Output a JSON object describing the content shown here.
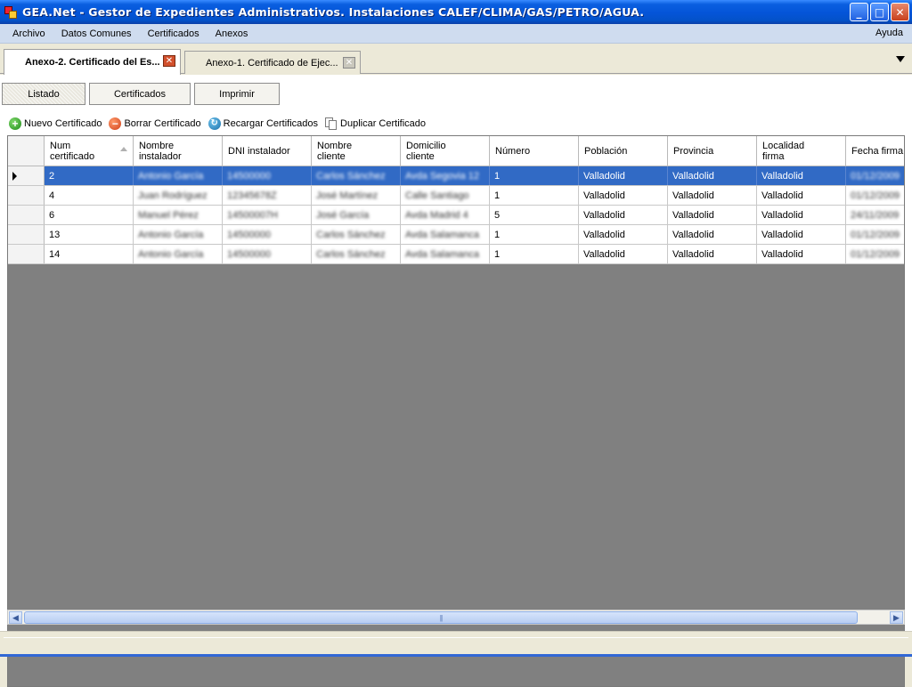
{
  "window": {
    "title": "GEA.Net - Gestor de Expedientes Administrativos. Instalaciones CALEF/CLIMA/GAS/PETRO/AGUA.",
    "controls": {
      "minimize": "_",
      "maximize": "□",
      "close": "✕"
    }
  },
  "menu": {
    "items": [
      "Archivo",
      "Datos Comunes",
      "Certificados",
      "Anexos"
    ],
    "help": "Ayuda"
  },
  "doc_tabs": [
    {
      "label": "Anexo-2. Certificado del Es...",
      "active": true
    },
    {
      "label": "Anexo-1.  Certificado  de  Ejec...",
      "active": false
    }
  ],
  "sub_tabs": [
    "Listado",
    "Certificados",
    "Imprimir"
  ],
  "toolbar": {
    "new": "Nuevo Certificado",
    "delete": "Borrar Certificado",
    "reload": "Recargar Certificados",
    "duplicate": "Duplicar Certificado"
  },
  "grid": {
    "columns": [
      "Num\ncertificado",
      "Nombre\ninstalador",
      "DNI instalador",
      "Nombre\ncliente",
      "Domicilio\ncliente",
      "Número",
      "Población",
      "Provincia",
      "Localidad\nfirma",
      "Fecha firma"
    ],
    "rows": [
      {
        "num": "2",
        "instalador": "Antonio García",
        "dni": "14500000",
        "cliente": "Carlos Sánchez",
        "domicilio": "Avda Segovia 12",
        "numero": "1",
        "poblacion": "Valladolid",
        "provincia": "Valladolid",
        "localidad": "Valladolid",
        "fecha": "01/12/2009",
        "selected": true
      },
      {
        "num": "4",
        "instalador": "Juan Rodríguez",
        "dni": "12345678Z",
        "cliente": "José Martínez",
        "domicilio": "Calle Santiago",
        "numero": "1",
        "poblacion": "Valladolid",
        "provincia": "Valladolid",
        "localidad": "Valladolid",
        "fecha": "01/12/2009",
        "selected": false
      },
      {
        "num": "6",
        "instalador": "Manuel Pérez",
        "dni": "14500007H",
        "cliente": "José García",
        "domicilio": "Avda Madrid 4",
        "numero": "5",
        "poblacion": "Valladolid",
        "provincia": "Valladolid",
        "localidad": "Valladolid",
        "fecha": "24/11/2009",
        "selected": false
      },
      {
        "num": "13",
        "instalador": "Antonio García",
        "dni": "14500000",
        "cliente": "Carlos Sánchez",
        "domicilio": "Avda Salamanca",
        "numero": "1",
        "poblacion": "Valladolid",
        "provincia": "Valladolid",
        "localidad": "Valladolid",
        "fecha": "01/12/2009",
        "selected": false
      },
      {
        "num": "14",
        "instalador": "Antonio García",
        "dni": "14500000",
        "cliente": "Carlos Sánchez",
        "domicilio": "Avda Salamanca",
        "numero": "1",
        "poblacion": "Valladolid",
        "provincia": "Valladolid",
        "localidad": "Valladolid",
        "fecha": "01/12/2009",
        "selected": false
      }
    ]
  },
  "colors": {
    "titlebar": "#0454d8",
    "menubar": "#cfdcef",
    "selection": "#316ac5",
    "grid_background": "#808080"
  }
}
